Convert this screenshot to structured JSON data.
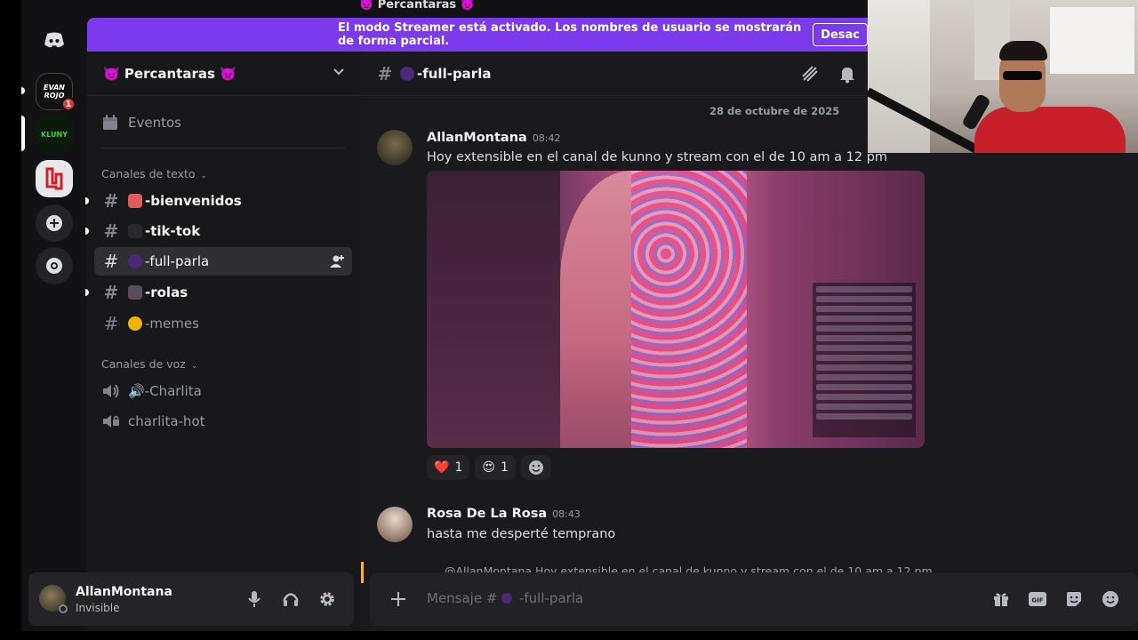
{
  "topbar": {
    "server_title": "👿 Percantaras 👿"
  },
  "banner": {
    "text": "El modo Streamer está activado. Los nombres de usuario se mostrarán de forma parcial.",
    "button_label": "Desac"
  },
  "rail": {
    "servers": [
      {
        "label": "EVAN ROJO",
        "badge": "1",
        "color": "#101010"
      },
      {
        "label": "KLUNY",
        "badge": "",
        "color": "#0c1a0c"
      },
      {
        "label": "",
        "badge": "",
        "color": "#e8e8e8"
      }
    ]
  },
  "sidebar": {
    "server_name": "👿 Percantaras 👿",
    "events_label": "Eventos",
    "text_category": "Canales de texto",
    "voice_category": "Canales de voz",
    "text_channels": [
      {
        "name": "-bienvenidos",
        "emoji_color": "#e05a5a"
      },
      {
        "name": "-tik-tok",
        "emoji_color": "#333"
      },
      {
        "name": "-full-parla",
        "emoji_color": "#5a2e8a"
      },
      {
        "name": "-rolas",
        "emoji_color": "#7a5a7a"
      },
      {
        "name": "-memes",
        "emoji_color": "#f0b400"
      }
    ],
    "voice_channels": [
      {
        "name": "🔊-Charlita"
      },
      {
        "name": "charlita-hot"
      }
    ]
  },
  "user_panel": {
    "name": "AllanMontana",
    "status": "Invisible"
  },
  "channel_header": {
    "name": "-full-parla"
  },
  "messages": {
    "date_divider": "28 de octubre de 2025",
    "first": {
      "author": "AllanMontana",
      "time": "08:42",
      "text": "Hoy extensible en el canal de kunno y stream con el de 10 am a 12 pm",
      "reactions": [
        {
          "emoji": "❤️",
          "count": "1"
        },
        {
          "emoji": "😍",
          "count": "1"
        }
      ]
    },
    "second": {
      "author": "Rosa De La Rosa",
      "time": "08:43",
      "text": "hasta me desperté temprano"
    },
    "reply_preview": "@AllanMontana Hoy extensible en el canal de kunno y stream con el de 10 am a 12 pm"
  },
  "composer": {
    "placeholder": "Mensaje #",
    "channel": "-full-parla"
  }
}
